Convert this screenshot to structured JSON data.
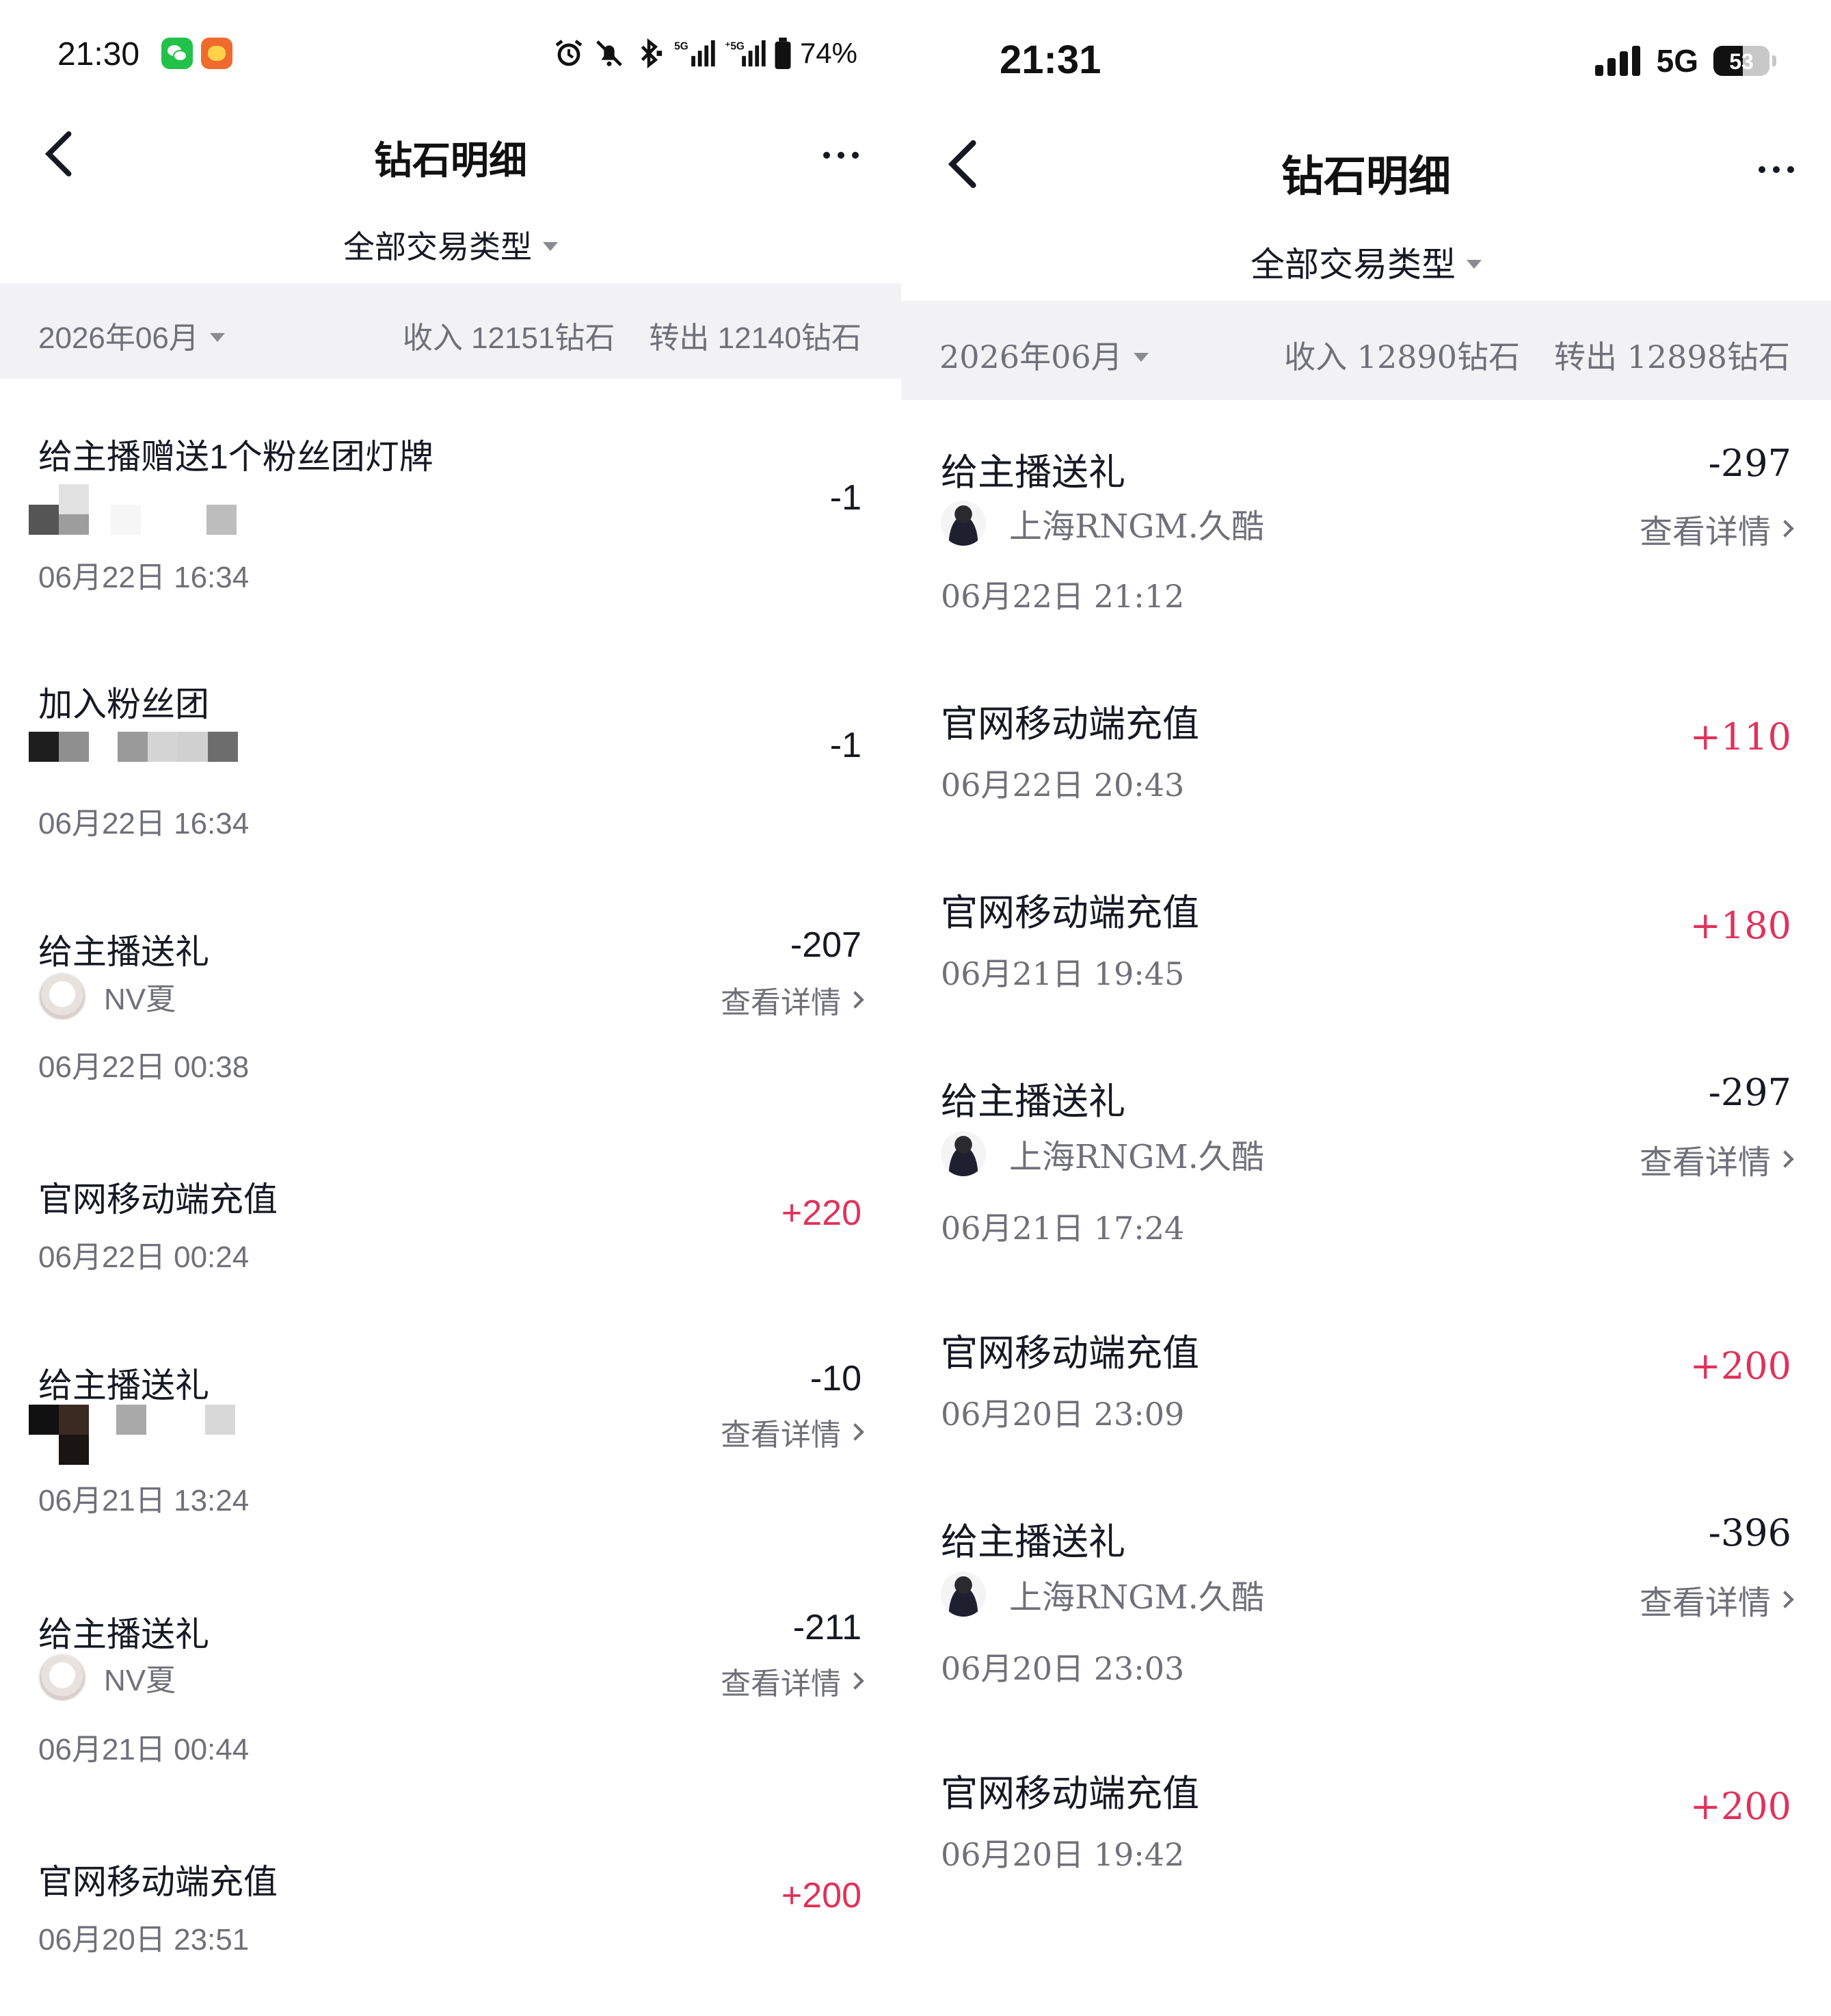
{
  "left": {
    "status": {
      "time": "21:30",
      "battery": "74%"
    },
    "nav": {
      "title": "钻石明细"
    },
    "filter": {
      "type_label": "全部交易类型"
    },
    "summary": {
      "month": "2026年06月",
      "income": "收入 12151钻石",
      "outgo": "转出 12140钻石"
    },
    "rows": [
      {
        "title": "给主播赠送1个粉丝团灯牌",
        "amount": "-1",
        "time": "06月22日 16:34",
        "sign": "neg"
      },
      {
        "title": "加入粉丝团",
        "amount": "-1",
        "time": "06月22日 16:34",
        "sign": "neg"
      },
      {
        "title": "给主播送礼",
        "amount": "-207",
        "user": "NV夏",
        "detail": "查看详情",
        "time": "06月22日 00:38",
        "sign": "neg"
      },
      {
        "title": "官网移动端充值",
        "amount": "+220",
        "time": "06月22日 00:24",
        "sign": "pos"
      },
      {
        "title": "给主播送礼",
        "amount": "-10",
        "detail": "查看详情",
        "time": "06月21日 13:24",
        "sign": "neg"
      },
      {
        "title": "给主播送礼",
        "amount": "-211",
        "user": "NV夏",
        "detail": "查看详情",
        "time": "06月21日 00:44",
        "sign": "neg"
      },
      {
        "title": "官网移动端充值",
        "amount": "+200",
        "time": "06月20日 23:51",
        "sign": "pos"
      }
    ]
  },
  "right": {
    "status": {
      "time": "21:31",
      "network": "5G",
      "battery": "53"
    },
    "nav": {
      "title": "钻石明细"
    },
    "filter": {
      "type_label": "全部交易类型"
    },
    "summary": {
      "month": "2026年06月",
      "income": "收入 12890钻石",
      "outgo": "转出 12898钻石"
    },
    "rows": [
      {
        "title": "给主播送礼",
        "amount": "-297",
        "user": "上海RNGM.久酷",
        "detail": "查看详情",
        "time": "06月22日 21:12",
        "sign": "neg"
      },
      {
        "title": "官网移动端充值",
        "amount": "+110",
        "time": "06月22日 20:43",
        "sign": "pos"
      },
      {
        "title": "官网移动端充值",
        "amount": "+180",
        "time": "06月21日 19:45",
        "sign": "pos"
      },
      {
        "title": "给主播送礼",
        "amount": "-297",
        "user": "上海RNGM.久酷",
        "detail": "查看详情",
        "time": "06月21日 17:24",
        "sign": "neg"
      },
      {
        "title": "官网移动端充值",
        "amount": "+200",
        "time": "06月20日 23:09",
        "sign": "pos"
      },
      {
        "title": "给主播送礼",
        "amount": "-396",
        "user": "上海RNGM.久酷",
        "detail": "查看详情",
        "time": "06月20日 23:03",
        "sign": "neg"
      },
      {
        "title": "官网移动端充值",
        "amount": "+200",
        "time": "06月20日 19:42",
        "sign": "pos"
      }
    ]
  },
  "colors": {
    "positive": "#e0325a",
    "negative": "#161823",
    "muted": "#6f7079",
    "summary_bg": "#f2f2f4"
  },
  "icons": [
    "back-chevron-icon",
    "more-dots-icon",
    "dropdown-caret-icon",
    "chevron-right-icon",
    "alarm-icon",
    "mute-bell-icon",
    "bluetooth-icon",
    "signal-icon",
    "battery-icon",
    "wechat-app-icon",
    "taobao-app-icon"
  ]
}
